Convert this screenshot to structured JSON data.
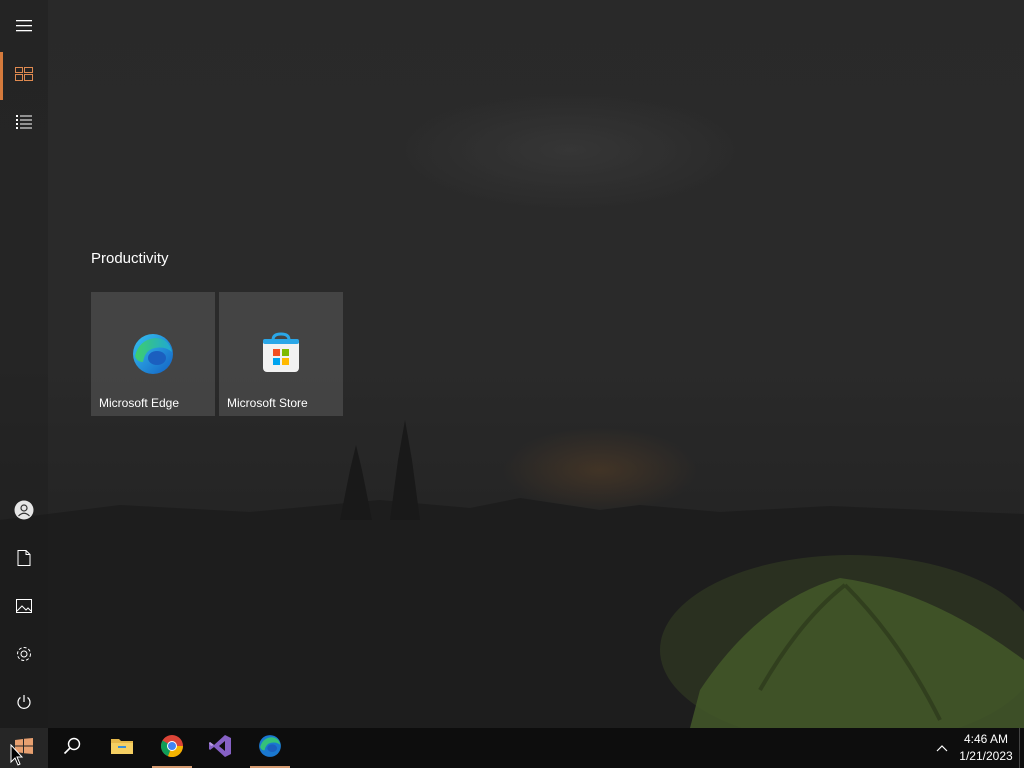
{
  "start_menu": {
    "group_title": "Productivity",
    "tiles": [
      {
        "label": "Microsoft Edge",
        "icon": "edge-icon"
      },
      {
        "label": "Microsoft Store",
        "icon": "store-icon"
      }
    ],
    "rail_top": [
      "hamburger-icon",
      "pinned-tiles-icon",
      "all-apps-list-icon"
    ],
    "rail_bottom": [
      "user-icon",
      "documents-icon",
      "pictures-icon",
      "settings-icon",
      "power-icon"
    ]
  },
  "taskbar": {
    "apps": [
      "windows-start-icon",
      "search-icon",
      "file-explorer-icon",
      "chrome-icon",
      "visual-studio-icon",
      "edge-icon"
    ],
    "accent_color": "#d47a3c"
  },
  "clock": {
    "time": "4:46 AM",
    "date": "1/21/2023"
  }
}
